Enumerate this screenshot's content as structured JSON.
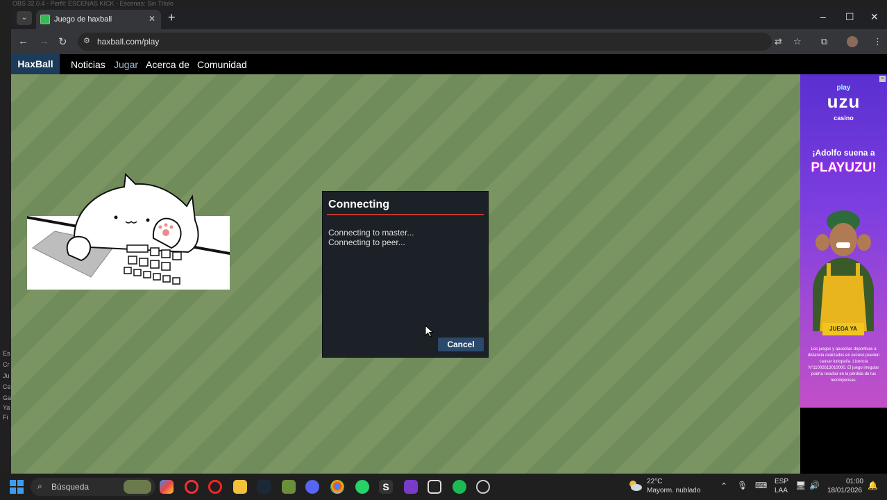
{
  "os": {
    "window_title": "OBS 32.0.4 - Perfil: ESCENAS KICK - Escenas: Sin Título",
    "side_labels": [
      "Es",
      "Cr",
      "Ju",
      "Ce",
      "Ga",
      "Ya",
      "Fi"
    ]
  },
  "browser": {
    "tab_title": "Juego de haxball",
    "url": "haxball.com/play",
    "controls": {
      "minimize": "–",
      "maximize": "☐",
      "close": "✕"
    }
  },
  "site_nav": {
    "brand": "HaxBall",
    "links": [
      "Noticias",
      "Jugar",
      "Acerca de",
      "Comunidad"
    ]
  },
  "dialog": {
    "title": "Connecting",
    "log": [
      "Connecting to master...",
      "Connecting to peer..."
    ],
    "cancel_label": "Cancel"
  },
  "ad": {
    "brand_top": "play",
    "brand_main": "uzu",
    "brand_sub": "casino",
    "headline": "¡Adolfo suena a",
    "headline_big": "PLAYUZU!",
    "cta": "JUEGA YA",
    "legal": "Los juegos y apuestas deportivas a distancia realizados en exceso pueden causar ludopatía. Licencia N°11002613010000. El juego irregular podría resultar en la pérdida de tus recompensas."
  },
  "taskbar": {
    "search_placeholder": "Búsqueda",
    "weather_temp": "22°C",
    "weather_desc": "Mayorm. nublado",
    "lang_1": "ESP",
    "lang_2": "LAA",
    "time": "01:00",
    "date": "18/01/2026"
  },
  "colors": {
    "field_a": "#7a9562",
    "field_b": "#718c5b",
    "dialog_bg": "#1b2126",
    "accent_line": "#c0392b",
    "button": "#2b4a6b",
    "brand_bg": "#1c3b5a"
  }
}
